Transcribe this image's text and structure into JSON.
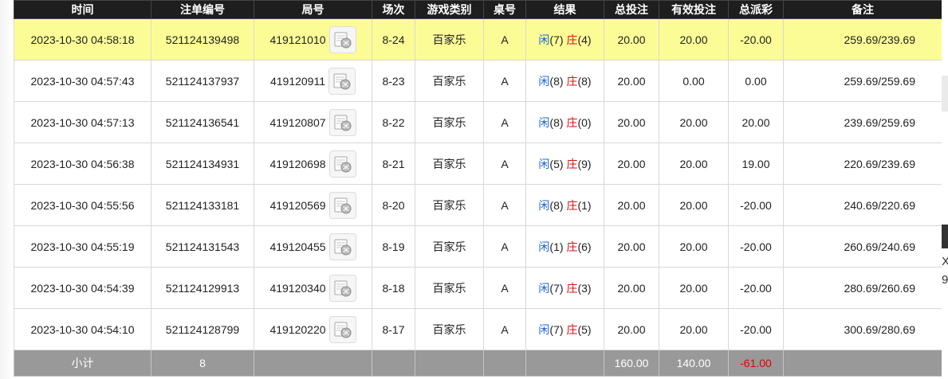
{
  "columns": [
    "时间",
    "注单编号",
    "局号",
    "场次",
    "游戏类别",
    "桌号",
    "结果",
    "总投注",
    "有效投注",
    "总派彩",
    "备注"
  ],
  "result_labels": {
    "player": "闲",
    "banker": "庄"
  },
  "rows": [
    {
      "time": "2023-10-30 04:58:18",
      "bet_id": "521124139498",
      "round_id": "419121010",
      "shoe": "8-24",
      "game": "百家乐",
      "table": "A",
      "player": "(7)",
      "banker": "(4)",
      "total_bet": "20.00",
      "valid_bet": "20.00",
      "payout": "-20.00",
      "remark": "259.69/239.69"
    },
    {
      "time": "2023-10-30 04:57:43",
      "bet_id": "521124137937",
      "round_id": "419120911",
      "shoe": "8-23",
      "game": "百家乐",
      "table": "A",
      "player": "(8)",
      "banker": "(8)",
      "total_bet": "20.00",
      "valid_bet": "0.00",
      "payout": "0.00",
      "remark": "259.69/259.69"
    },
    {
      "time": "2023-10-30 04:57:13",
      "bet_id": "521124136541",
      "round_id": "419120807",
      "shoe": "8-22",
      "game": "百家乐",
      "table": "A",
      "player": "(8)",
      "banker": "(0)",
      "total_bet": "20.00",
      "valid_bet": "20.00",
      "payout": "20.00",
      "remark": "239.69/259.69"
    },
    {
      "time": "2023-10-30 04:56:38",
      "bet_id": "521124134931",
      "round_id": "419120698",
      "shoe": "8-21",
      "game": "百家乐",
      "table": "A",
      "player": "(5)",
      "banker": "(9)",
      "total_bet": "20.00",
      "valid_bet": "20.00",
      "payout": "19.00",
      "remark": "220.69/239.69"
    },
    {
      "time": "2023-10-30 04:55:56",
      "bet_id": "521124133181",
      "round_id": "419120569",
      "shoe": "8-20",
      "game": "百家乐",
      "table": "A",
      "player": "(8)",
      "banker": "(1)",
      "total_bet": "20.00",
      "valid_bet": "20.00",
      "payout": "-20.00",
      "remark": "240.69/220.69"
    },
    {
      "time": "2023-10-30 04:55:19",
      "bet_id": "521124131543",
      "round_id": "419120455",
      "shoe": "8-19",
      "game": "百家乐",
      "table": "A",
      "player": "(1)",
      "banker": "(6)",
      "total_bet": "20.00",
      "valid_bet": "20.00",
      "payout": "-20.00",
      "remark": "260.69/240.69"
    },
    {
      "time": "2023-10-30 04:54:39",
      "bet_id": "521124129913",
      "round_id": "419120340",
      "shoe": "8-18",
      "game": "百家乐",
      "table": "A",
      "player": "(7)",
      "banker": "(3)",
      "total_bet": "20.00",
      "valid_bet": "20.00",
      "payout": "-20.00",
      "remark": "280.69/260.69"
    },
    {
      "time": "2023-10-30 04:54:10",
      "bet_id": "521124128799",
      "round_id": "419120220",
      "shoe": "8-17",
      "game": "百家乐",
      "table": "A",
      "player": "(7)",
      "banker": "(5)",
      "total_bet": "20.00",
      "valid_bet": "20.00",
      "payout": "-20.00",
      "remark": "300.69/280.69"
    }
  ],
  "subtotal": {
    "label": "小计",
    "count": "8",
    "total_bet": "160.00",
    "valid_bet": "140.00",
    "payout": "-61.00"
  },
  "edge_glyphs": [
    "X",
    "9"
  ],
  "colors": {
    "header_bg": "#1e1e1e",
    "highlight_row": "#fcfc96",
    "footer_bg": "#999999",
    "player_blue": "#1a66d6",
    "banker_red": "#e01010",
    "negative_red": "#e00000"
  },
  "icons": {
    "replay": "video-replay-icon"
  }
}
